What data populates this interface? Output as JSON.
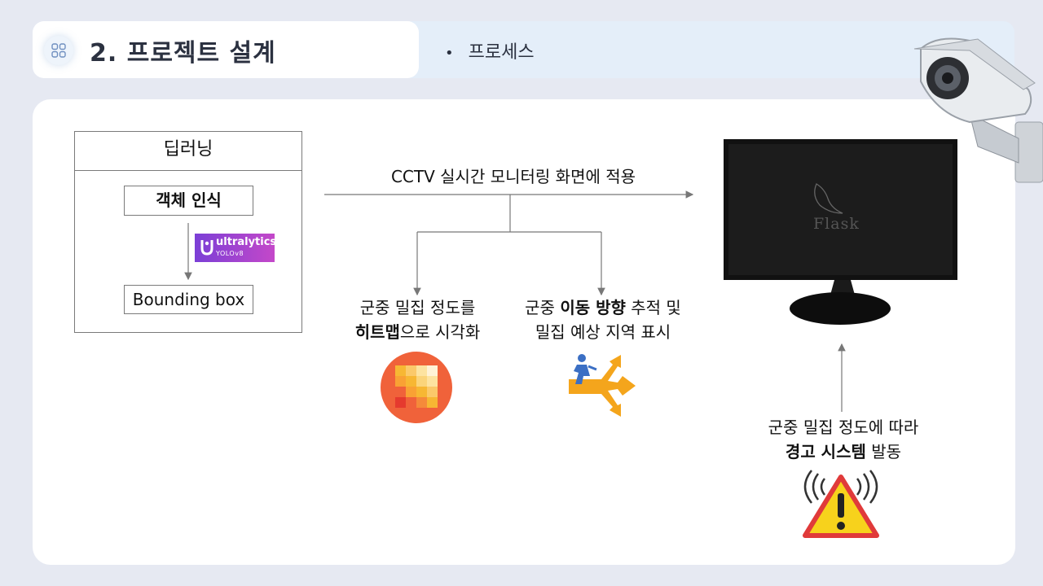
{
  "header": {
    "title": "2. 프로젝트 설계",
    "process_label": "프로세스",
    "icon": "grid-icon"
  },
  "deep_learning": {
    "title": "딥러닝",
    "object_detection": "객체 인식",
    "bounding_box": "Bounding box",
    "yolo_badge": {
      "brand": "ultralytics",
      "sub": "YOLOv8"
    }
  },
  "flow": {
    "cctv_caption": "CCTV 실시간 모니터링 화면에 적용",
    "heatmap_caption": {
      "line1": "군중 밀집 정도를",
      "line2_bold": "히트맵",
      "line2_rest": "으로 시각화"
    },
    "movement_caption": {
      "line1_prefix": "군중 ",
      "line1_bold": "이동 방향",
      "line1_suffix": " 추적 및",
      "line2": "밀집 예상 지역 표시"
    },
    "warning_caption": {
      "line1": "군중 밀집 정도에 따라",
      "line2_bold": "경고 시스템",
      "line2_rest": " 발동"
    }
  },
  "monitor": {
    "screen_text": "Flask"
  },
  "icons": [
    "cctv-camera-icon",
    "monitor-icon",
    "flask-logo-icon",
    "heatmap-icon",
    "direction-arrows-icon",
    "warning-icon"
  ],
  "colors": {
    "background": "#e6e9f2",
    "header_bar": "#e4eef9",
    "title_text": "#2b3140",
    "yolo_gradient_start": "#7b3fd6",
    "yolo_gradient_end": "#c448c9",
    "warning_red": "#e03a3a",
    "warning_yellow": "#f7d21c"
  }
}
